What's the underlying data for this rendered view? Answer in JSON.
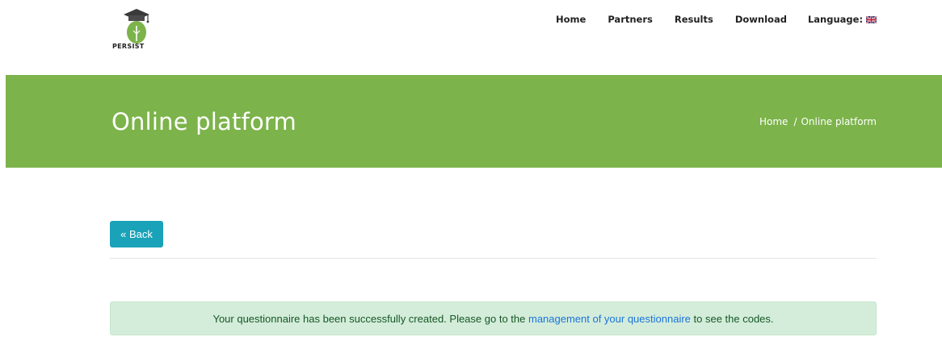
{
  "header": {
    "logo_text": "PERSIST",
    "nav": {
      "home": "Home",
      "partners": "Partners",
      "results": "Results",
      "download": "Download",
      "language_label": "Language:",
      "language_icon": "uk-flag-icon"
    }
  },
  "banner": {
    "title": "Online platform",
    "breadcrumb": {
      "home": "Home",
      "separator": "/",
      "current": "Online platform"
    },
    "color": "#7cb34a"
  },
  "main": {
    "back_button": "« Back",
    "back_color": "#1aa2b8",
    "alert": {
      "before": "Your questionnaire has been successfully created. Please go to the",
      "link": "management of your questionnaire",
      "after": "to see the codes.",
      "bg_color": "#d4edda"
    }
  }
}
